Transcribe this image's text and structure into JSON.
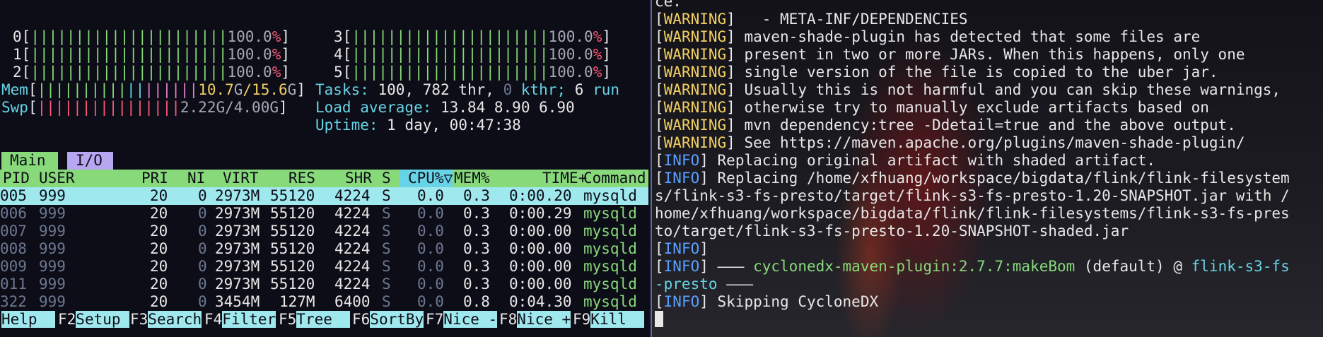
{
  "htop": {
    "cpus_left": [
      {
        "id": "0",
        "bar": "||||||||||||||||||||||",
        "value": "100.0",
        "unit": "%"
      },
      {
        "id": "1",
        "bar": "||||||||||||||||||||||",
        "value": "100.0",
        "unit": "%"
      },
      {
        "id": "2",
        "bar": "||||||||||||||||||||||",
        "value": "100.0",
        "unit": "%"
      }
    ],
    "cpus_right": [
      {
        "id": "3",
        "bar": "||||||||||||||||||||||",
        "value": "100.0",
        "unit": "%"
      },
      {
        "id": "4",
        "bar": "||||||||||||||||||||||",
        "value": "100.0",
        "unit": "%"
      },
      {
        "id": "5",
        "bar": "||||||||||||||||||||||",
        "value": "100.0",
        "unit": "%"
      }
    ],
    "mem": {
      "label": "Mem",
      "bar": "||||||||||||||||||",
      "used": "10.7",
      "used_unit": "G",
      "total": "15.6",
      "total_unit": "G"
    },
    "swp": {
      "label": "Swp",
      "bar": "||||||||||||||||",
      "used": "2.22G",
      "total": "4.00G"
    },
    "tasks": {
      "label": "Tasks:",
      "count": "100,",
      "thr": "782 thr,",
      "kthr_num": "0",
      "kthr": "kthr;",
      "run_num": "6",
      "run": "run"
    },
    "load": {
      "label": "Load average:",
      "values": "13.84 8.90 6.90"
    },
    "uptime": {
      "label": "Uptime:",
      "value": "1 day, 00:47:38"
    },
    "tabs": {
      "main": "Main",
      "io": "I/O"
    },
    "columns": {
      "pid": "PID",
      "user": "USER",
      "pri": "PRI",
      "ni": "NI",
      "virt": "VIRT",
      "res": "RES",
      "shr": "SHR",
      "s": "S",
      "cpu": "CPU%▽",
      "mem": "MEM%",
      "time": "TIME+",
      "command": "Command"
    },
    "processes": [
      {
        "pid": "005",
        "user": "999",
        "pri": "20",
        "ni": "0",
        "virt": "2973M",
        "res": "55120",
        "shr": "4224",
        "s": "S",
        "cpu": "0.0",
        "mem": "0.3",
        "time": "0:00.20",
        "command": "mysqld"
      },
      {
        "pid": "006",
        "user": "999",
        "pri": "20",
        "ni": "0",
        "virt": "2973M",
        "res": "55120",
        "shr": "4224",
        "s": "S",
        "cpu": "0.0",
        "mem": "0.3",
        "time": "0:00.29",
        "command": "mysqld"
      },
      {
        "pid": "007",
        "user": "999",
        "pri": "20",
        "ni": "0",
        "virt": "2973M",
        "res": "55120",
        "shr": "4224",
        "s": "S",
        "cpu": "0.0",
        "mem": "0.3",
        "time": "0:00.00",
        "command": "mysqld"
      },
      {
        "pid": "008",
        "user": "999",
        "pri": "20",
        "ni": "0",
        "virt": "2973M",
        "res": "55120",
        "shr": "4224",
        "s": "S",
        "cpu": "0.0",
        "mem": "0.3",
        "time": "0:00.00",
        "command": "mysqld"
      },
      {
        "pid": "009",
        "user": "999",
        "pri": "20",
        "ni": "0",
        "virt": "2973M",
        "res": "55120",
        "shr": "4224",
        "s": "S",
        "cpu": "0.0",
        "mem": "0.3",
        "time": "0:00.00",
        "command": "mysqld"
      },
      {
        "pid": "011",
        "user": "999",
        "pri": "20",
        "ni": "0",
        "virt": "2973M",
        "res": "55120",
        "shr": "4224",
        "s": "S",
        "cpu": "0.0",
        "mem": "0.3",
        "time": "0:00.00",
        "command": "mysqld"
      },
      {
        "pid": "322",
        "user": "999",
        "pri": "20",
        "ni": "0",
        "virt": "3454M",
        "res": "127M",
        "shr": "6400",
        "s": "S",
        "cpu": "0.0",
        "mem": "0.8",
        "time": "0:04.30",
        "command": "mysqld"
      }
    ],
    "fkeys": [
      {
        "num": "",
        "label": "Help  "
      },
      {
        "num": "F2",
        "label": "Setup "
      },
      {
        "num": "F3",
        "label": "Search"
      },
      {
        "num": "F4",
        "label": "Filter"
      },
      {
        "num": "F5",
        "label": "Tree  "
      },
      {
        "num": "F6",
        "label": "SortBy"
      },
      {
        "num": "F7",
        "label": "Nice -"
      },
      {
        "num": "F8",
        "label": "Nice +"
      },
      {
        "num": "F9",
        "label": "Kill  "
      }
    ]
  },
  "terminal": {
    "top_fragment": "ce.",
    "lines": [
      {
        "tag": "WARNING",
        "text": "   - META-INF/DEPENDENCIES"
      },
      {
        "tag": "WARNING",
        "text": " maven-shade-plugin has detected that some files are"
      },
      {
        "tag": "WARNING",
        "text": " present in two or more JARs. When this happens, only one"
      },
      {
        "tag": "WARNING",
        "text": " single version of the file is copied to the uber jar."
      },
      {
        "tag": "WARNING",
        "text": " Usually this is not harmful and you can skip these warnings,"
      },
      {
        "tag": "WARNING",
        "text": " otherwise try to manually exclude artifacts based on"
      },
      {
        "tag": "WARNING",
        "text": " mvn dependency:tree -Ddetail=true and the above output."
      },
      {
        "tag": "WARNING",
        "text": " See https://maven.apache.org/plugins/maven-shade-plugin/"
      },
      {
        "tag": "INFO",
        "text": " Replacing original artifact with shaded artifact."
      },
      {
        "tag": "INFO",
        "text": " Replacing /home/xfhuang/workspace/bigdata/flink/flink-filesystem"
      }
    ],
    "wrapped": [
      "s/flink-s3-fs-presto/target/flink-s3-fs-presto-1.20-SNAPSHOT.jar with /",
      "home/xfhuang/workspace/bigdata/flink/flink-filesystems/flink-s3-fs-pres",
      "to/target/flink-s3-fs-presto-1.20-SNAPSHOT-shaded.jar"
    ],
    "info_empty": {
      "tag": "INFO"
    },
    "plugin_line": {
      "tag": "INFO",
      "dashes": " ——— ",
      "plugin": "cyclonedx-maven-plugin:2.7.7:makeBom",
      "goal": " (default) ",
      "at": "@",
      "project": " flink-s3-fs"
    },
    "plugin_cont": {
      "project": "-presto",
      "dashes": " ———"
    },
    "last": {
      "tag": "INFO",
      "text": " Skipping CycloneDX"
    },
    "colors": {
      "warning": "#f2cf63",
      "info": "#5aa0ff",
      "plugin": "#87d97a",
      "project": "#67d3e6"
    }
  }
}
